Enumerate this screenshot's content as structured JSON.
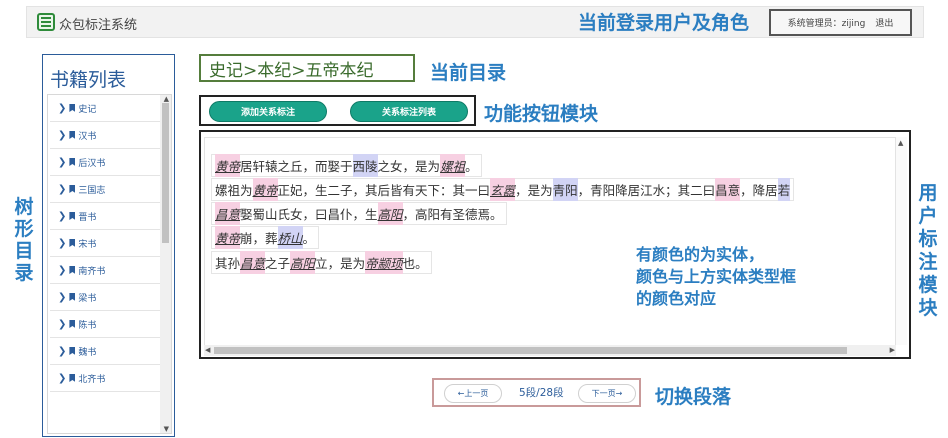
{
  "header": {
    "app_title": "众包标注系统",
    "user_annotation": "当前登录用户及角色",
    "user_info": "系统管理员：zijing",
    "logout": "退出"
  },
  "sidebar": {
    "title": "书籍列表",
    "annotation": "树形目录",
    "items": [
      "史记",
      "汉书",
      "后汉书",
      "三国志",
      "晋书",
      "宋书",
      "南齐书",
      "梁书",
      "陈书",
      "魏书",
      "北齐书"
    ]
  },
  "breadcrumb": {
    "path": "史记>本纪>五帝本纪",
    "annotation": "当前目录"
  },
  "toolbar": {
    "add_relation": "添加关系标注",
    "relation_list": "关系标注列表",
    "annotation": "功能按钮模块"
  },
  "annotation_area": {
    "annotation": "用户标注模块",
    "note_lines": [
      "有颜色的为实体，",
      "颜色与上方实体类型框",
      "的颜色对应"
    ],
    "lines": [
      [
        {
          "t": "黄帝",
          "c": "p",
          "i": true
        },
        {
          "t": "居轩辕之丘，而娶于"
        },
        {
          "t": "西陵",
          "c": "b"
        },
        {
          "t": "之女，是为"
        },
        {
          "t": "嫘祖",
          "c": "p",
          "i": true
        },
        {
          "t": "。"
        }
      ],
      [
        {
          "t": "嫘祖为"
        },
        {
          "t": "黄帝",
          "c": "p",
          "i": true
        },
        {
          "t": "正妃，生二子，其后皆有天下：其一曰"
        },
        {
          "t": "玄嚣",
          "c": "p",
          "i": true
        },
        {
          "t": "，是为"
        },
        {
          "t": "青阳",
          "c": "b"
        },
        {
          "t": "，青阳降居江水；其二曰"
        },
        {
          "t": "昌意",
          "c": "p"
        },
        {
          "t": "，降居"
        },
        {
          "t": "若",
          "c": "b"
        }
      ],
      [
        {
          "t": "昌意",
          "c": "p",
          "i": true
        },
        {
          "t": "娶蜀山氏女，曰昌仆，生"
        },
        {
          "t": "高阳",
          "c": "p",
          "i": true
        },
        {
          "t": "，高阳有圣德焉。"
        }
      ],
      [
        {
          "t": "黄帝",
          "c": "p",
          "i": true
        },
        {
          "t": "崩，葬"
        },
        {
          "t": "桥山",
          "c": "b",
          "i": true
        },
        {
          "t": "。"
        }
      ],
      [
        {
          "t": "其孙"
        },
        {
          "t": "昌意",
          "c": "p",
          "i": true
        },
        {
          "t": "之子"
        },
        {
          "t": "高阳",
          "c": "p",
          "i": true
        },
        {
          "t": "立，是为"
        },
        {
          "t": "帝颛顼",
          "c": "p",
          "i": true
        },
        {
          "t": "也。"
        }
      ]
    ]
  },
  "pager": {
    "prev": "←上一页",
    "info": "5段/28段",
    "next": "下一页→",
    "annotation": "切换段落"
  },
  "colors": {
    "entity_person": "#f7d0e2",
    "entity_place": "#d2d4f5",
    "annotation_text": "#2b7ec1",
    "button": "#1aa38a"
  }
}
